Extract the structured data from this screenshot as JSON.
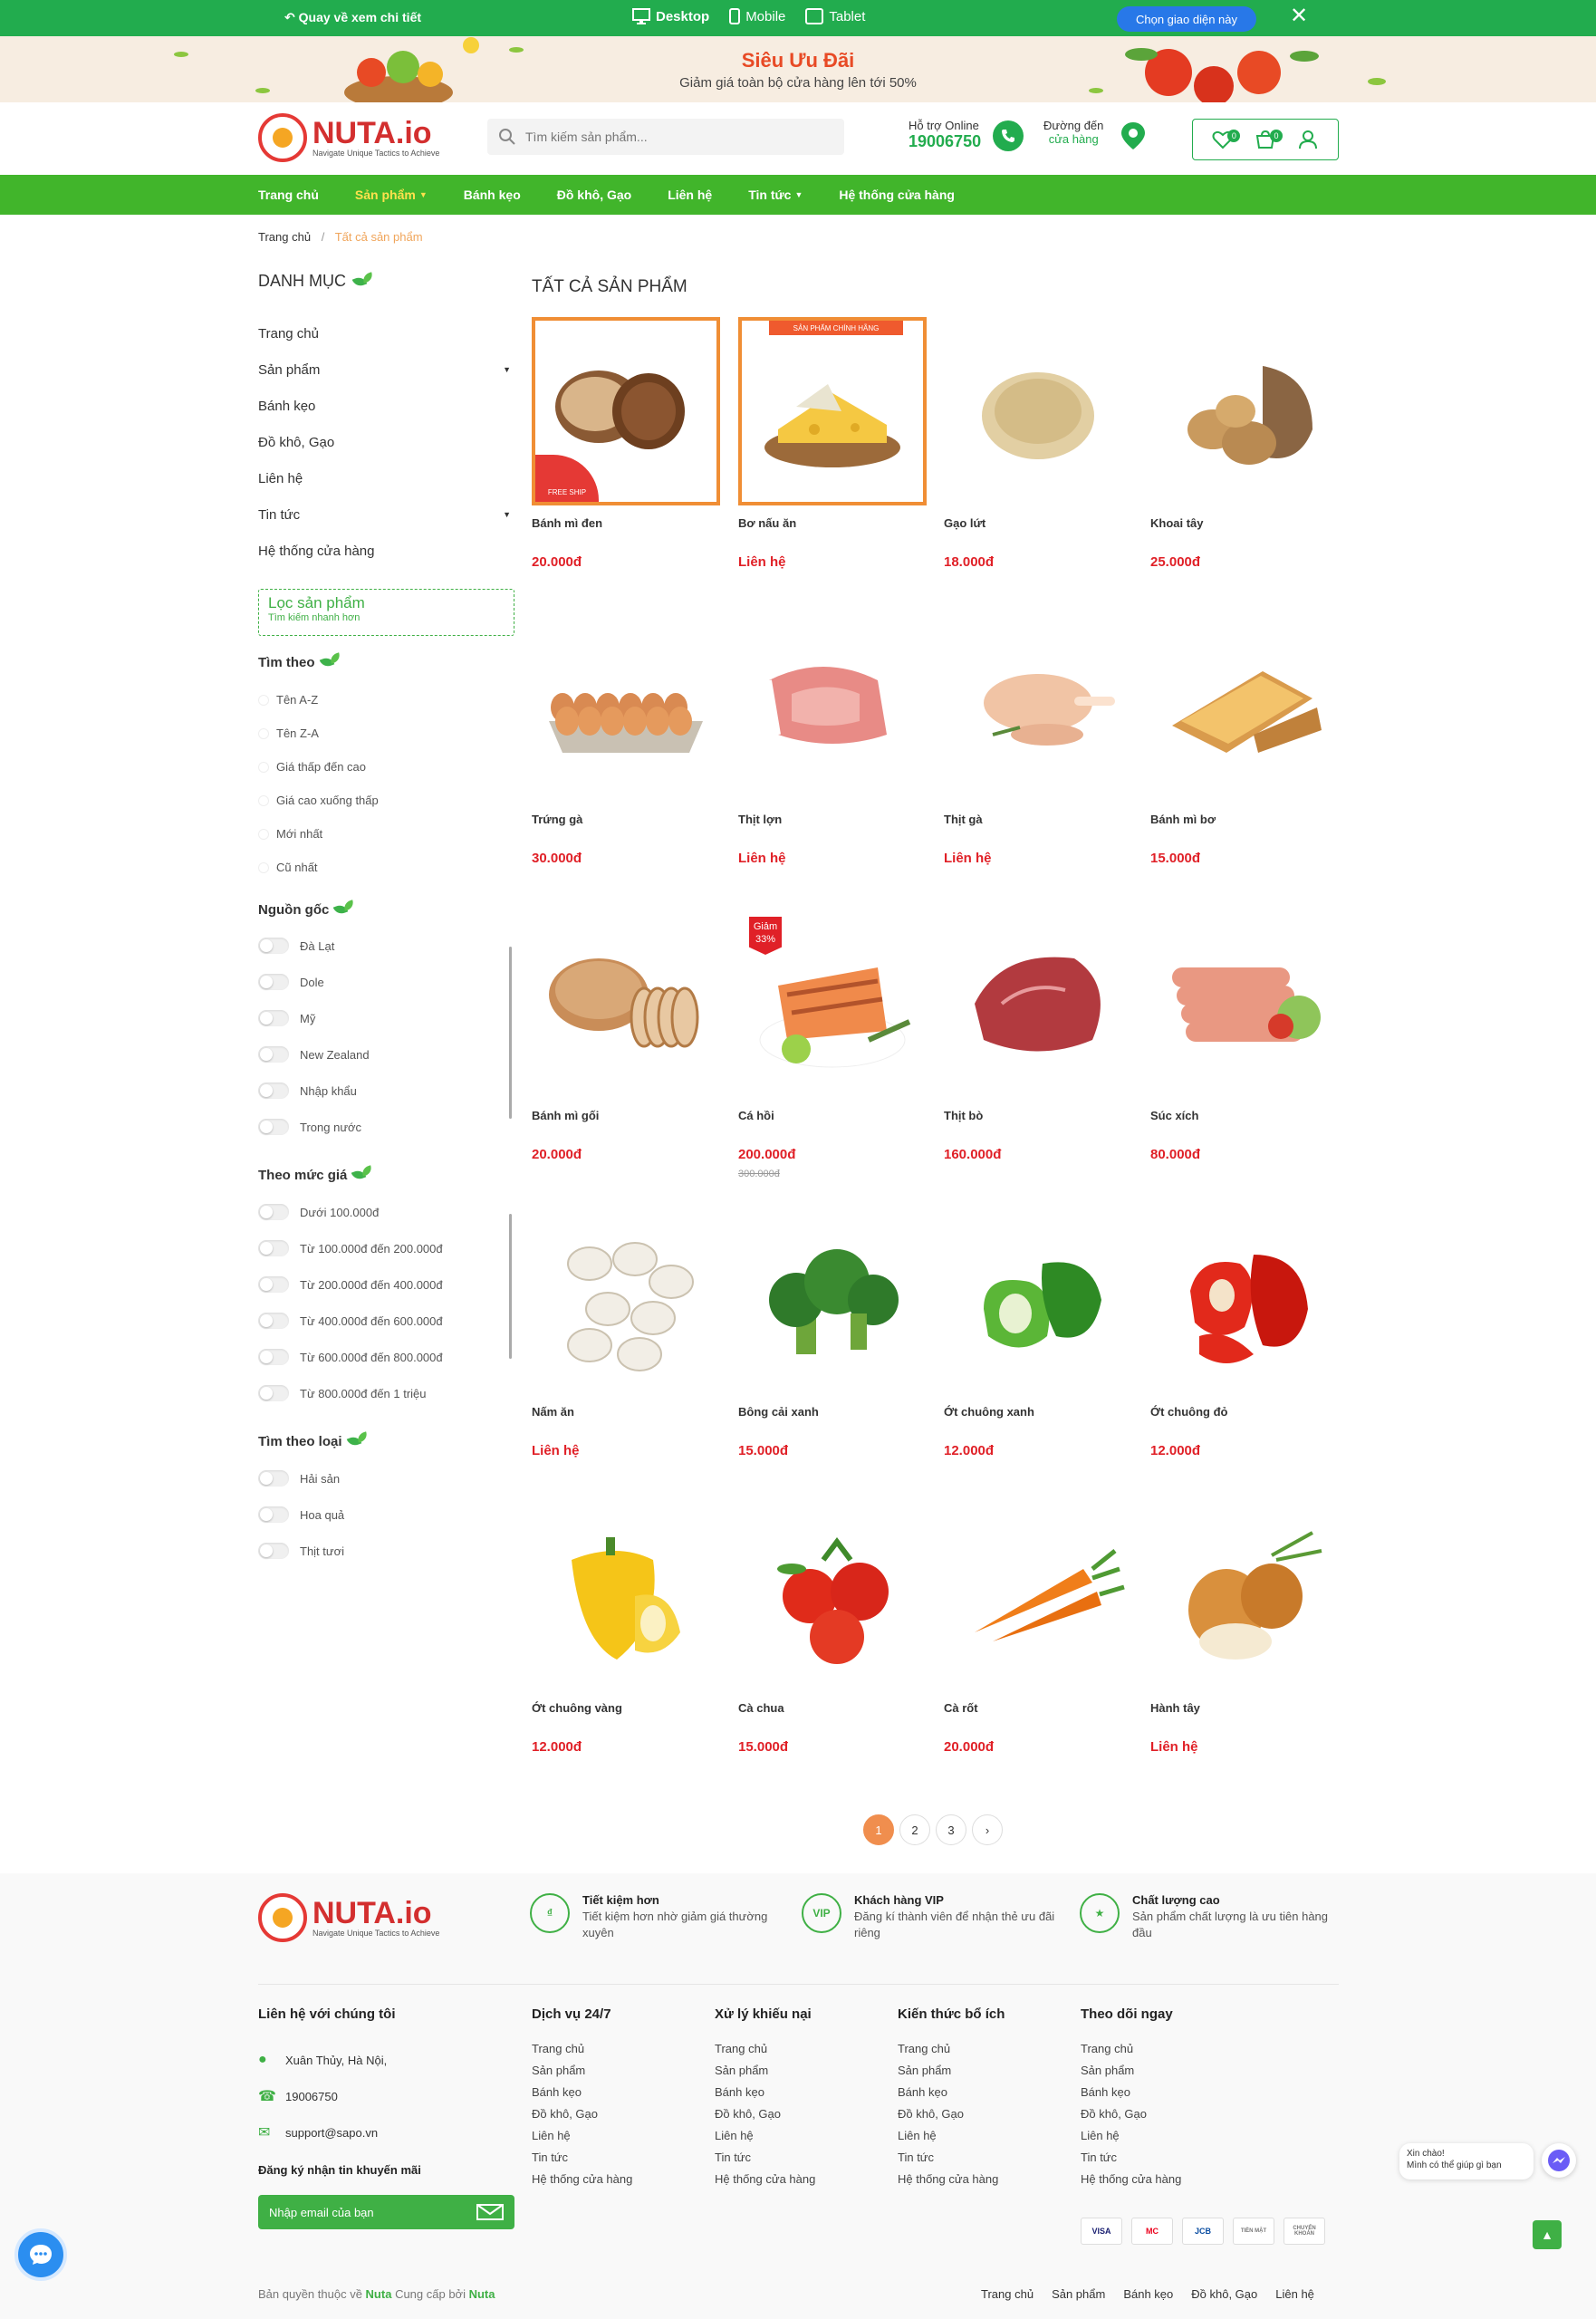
{
  "topbar": {
    "back_label": "Quay về xem chi tiết",
    "devices": [
      {
        "label": "Desktop",
        "active": true
      },
      {
        "label": "Mobile",
        "active": false
      },
      {
        "label": "Tablet",
        "active": false
      }
    ],
    "choose_label": "Chọn giao diện này"
  },
  "promo": {
    "title": "Siêu Ưu Đãi",
    "subtitle": "Giảm giá toàn bộ cửa hàng lên tới 50%"
  },
  "header": {
    "logo_name": "NUTA.io",
    "logo_tagline": "Navigate Unique Tactics to Achieve",
    "search_placeholder": "Tìm kiếm sản phẩm...",
    "hotline_label": "Hỗ trợ Online",
    "hotline_number": "19006750",
    "store_label1": "Đường đến",
    "store_label2": "cửa hàng",
    "wishlist_count": "0",
    "cart_count": "0"
  },
  "nav": {
    "items": [
      {
        "label": "Trang chủ",
        "active": false,
        "dropdown": false
      },
      {
        "label": "Sản phẩm",
        "active": true,
        "dropdown": true
      },
      {
        "label": "Bánh kẹo",
        "active": false,
        "dropdown": false
      },
      {
        "label": "Đồ khô, Gạo",
        "active": false,
        "dropdown": false
      },
      {
        "label": "Liên hệ",
        "active": false,
        "dropdown": false
      },
      {
        "label": "Tin tức",
        "active": false,
        "dropdown": true
      },
      {
        "label": "Hệ thống cửa hàng",
        "active": false,
        "dropdown": false
      }
    ]
  },
  "breadcrumb": {
    "home": "Trang chủ",
    "separator": "/",
    "current": "Tất cả sản phẩm"
  },
  "sidebar": {
    "title": "DANH MỤC",
    "categories": [
      {
        "label": "Trang chủ",
        "dropdown": false
      },
      {
        "label": "Sản phẩm",
        "dropdown": true
      },
      {
        "label": "Bánh kẹo",
        "dropdown": false
      },
      {
        "label": "Đồ khô, Gạo",
        "dropdown": false
      },
      {
        "label": "Liên hệ",
        "dropdown": false
      },
      {
        "label": "Tin tức",
        "dropdown": true
      },
      {
        "label": "Hệ thống cửa hàng",
        "dropdown": false
      }
    ],
    "filter_title": "Lọc sản phẩm",
    "filter_subtitle": "Tìm kiếm nhanh hơn",
    "sort": {
      "title": "Tìm theo",
      "options": [
        "Tên A-Z",
        "Tên Z-A",
        "Giá thấp đến cao",
        "Giá cao xuống thấp",
        "Mới nhất",
        "Cũ nhất"
      ]
    },
    "origin": {
      "title": "Nguồn gốc",
      "options": [
        "Đà Lạt",
        "Dole",
        "Mỹ",
        "New Zealand",
        "Nhập khẩu",
        "Trong nước"
      ]
    },
    "price": {
      "title": "Theo mức giá",
      "options": [
        "Dưới 100.000đ",
        "Từ 100.000đ đến 200.000đ",
        "Từ 200.000đ đến 400.000đ",
        "Từ 400.000đ đến 600.000đ",
        "Từ 600.000đ đến 800.000đ",
        "Từ 800.000đ đến 1 triệu"
      ]
    },
    "type": {
      "title": "Tìm theo loại",
      "options": [
        "Hải sản",
        "Hoa quả",
        "Thịt tươi"
      ]
    }
  },
  "products": {
    "title": "TẤT CẢ SẢN PHẨM",
    "items": [
      {
        "name": "Bánh mì đen",
        "price": "20.000đ",
        "art": "bread",
        "badge": "free-ship",
        "highlight": true
      },
      {
        "name": "Bơ nấu ăn",
        "price": "Liên hệ",
        "art": "cheese",
        "badge": "official",
        "highlight": true
      },
      {
        "name": "Gạo lứt",
        "price": "18.000đ",
        "art": "rice"
      },
      {
        "name": "Khoai tây",
        "price": "25.000đ",
        "art": "potato"
      },
      {
        "name": "Trứng gà",
        "price": "30.000đ",
        "art": "eggs"
      },
      {
        "name": "Thịt lợn",
        "price": "Liên hệ",
        "art": "pork"
      },
      {
        "name": "Thịt gà",
        "price": "Liên hệ",
        "art": "chicken"
      },
      {
        "name": "Bánh mì bơ",
        "price": "15.000đ",
        "art": "toast"
      },
      {
        "name": "Bánh mì gối",
        "price": "20.000đ",
        "art": "loaf"
      },
      {
        "name": "Cá hồi",
        "price": "200.000đ",
        "old_price": "300.000đ",
        "art": "salmon",
        "badge": "sale"
      },
      {
        "name": "Thịt bò",
        "price": "160.000đ",
        "art": "beef"
      },
      {
        "name": "Súc xích",
        "price": "80.000đ",
        "art": "sausage"
      },
      {
        "name": "Nấm ăn",
        "price": "Liên hệ",
        "art": "mushroom"
      },
      {
        "name": "Bông cải xanh",
        "price": "15.000đ",
        "art": "broccoli"
      },
      {
        "name": "Ớt chuông xanh",
        "price": "12.000đ",
        "art": "green-pepper"
      },
      {
        "name": "Ớt chuông đỏ",
        "price": "12.000đ",
        "art": "red-pepper"
      },
      {
        "name": "Ớt chuông vàng",
        "price": "12.000đ",
        "art": "yellow-pepper"
      },
      {
        "name": "Cà chua",
        "price": "15.000đ",
        "art": "tomato"
      },
      {
        "name": "Cà rốt",
        "price": "20.000đ",
        "art": "carrot"
      },
      {
        "name": "Hành tây",
        "price": "Liên hệ",
        "art": "onion"
      }
    ],
    "badges": {
      "free_ship": "FREE SHIP",
      "official": "SẢN PHẨM CHÍNH HÃNG",
      "sale_line1": "Giảm",
      "sale_line2": "33%"
    }
  },
  "pagination": {
    "pages": [
      "1",
      "2",
      "3"
    ],
    "current": "1",
    "next": "›"
  },
  "footer": {
    "logo_name": "NUTA.io",
    "logo_tagline": "Navigate Unique Tactics to Achieve",
    "highlights": [
      {
        "title": "Tiết kiệm hơn",
        "desc": "Tiết kiệm hơn nhờ giảm giá thường xuyên",
        "icon": "piggy-icon"
      },
      {
        "title": "Khách hàng VIP",
        "desc": "Đăng kí thành viên để nhận thẻ ưu đãi riêng",
        "icon": "vip-card-icon"
      },
      {
        "title": "Chất lượng cao",
        "desc": "Sản phẩm chất lượng là ưu tiên hàng đầu",
        "icon": "medal-icon"
      }
    ],
    "contact": {
      "title": "Liên hệ với chúng tôi",
      "address": "Xuân Thủy, Hà Nội,",
      "phone": "19006750",
      "email": "support@sapo.vn",
      "subscribe_title": "Đăng ký nhận tin khuyến mãi",
      "subscribe_placeholder": "Nhập email của bạn"
    },
    "columns": [
      {
        "title": "Dịch vụ 24/7",
        "links": [
          "Trang chủ",
          "Sản phẩm",
          "Bánh kẹo",
          "Đồ khô, Gạo",
          "Liên hệ",
          "Tin tức",
          "Hệ thống cửa hàng"
        ]
      },
      {
        "title": "Xử lý khiếu nại",
        "links": [
          "Trang chủ",
          "Sản phẩm",
          "Bánh kẹo",
          "Đồ khô, Gạo",
          "Liên hệ",
          "Tin tức",
          "Hệ thống cửa hàng"
        ]
      },
      {
        "title": "Kiến thức bổ ích",
        "links": [
          "Trang chủ",
          "Sản phẩm",
          "Bánh kẹo",
          "Đồ khô, Gạo",
          "Liên hệ",
          "Tin tức",
          "Hệ thống cửa hàng"
        ]
      },
      {
        "title": "Theo dõi ngay",
        "links": [
          "Trang chủ",
          "Sản phẩm",
          "Bánh kẹo",
          "Đồ khô, Gạo",
          "Liên hệ",
          "Tin tức",
          "Hệ thống cửa hàng"
        ]
      }
    ],
    "payments": [
      "VISA",
      "MC",
      "JCB",
      "TIỀN MẶT",
      "CHUYỂN KHOẢN"
    ],
    "copyright_prefix": "Bản quyền thuộc về",
    "copyright_brand": "Nuta",
    "copyright_mid": "Cung cấp bởi",
    "copyright_provider": "Nuta",
    "bottom_menu": [
      "Trang chủ",
      "Sản phẩm",
      "Bánh kẹo",
      "Đồ khô, Gạo",
      "Liên hệ"
    ]
  },
  "chat": {
    "line1": "Xin chào!",
    "line2": "Mình có thể giúp gì bạn"
  },
  "colors": {
    "brand_green": "#22ac4e",
    "nav_green": "#41b52b",
    "price_red": "#e02027",
    "accent_orange": "#f08e35",
    "active_nav": "#ffe14d"
  }
}
